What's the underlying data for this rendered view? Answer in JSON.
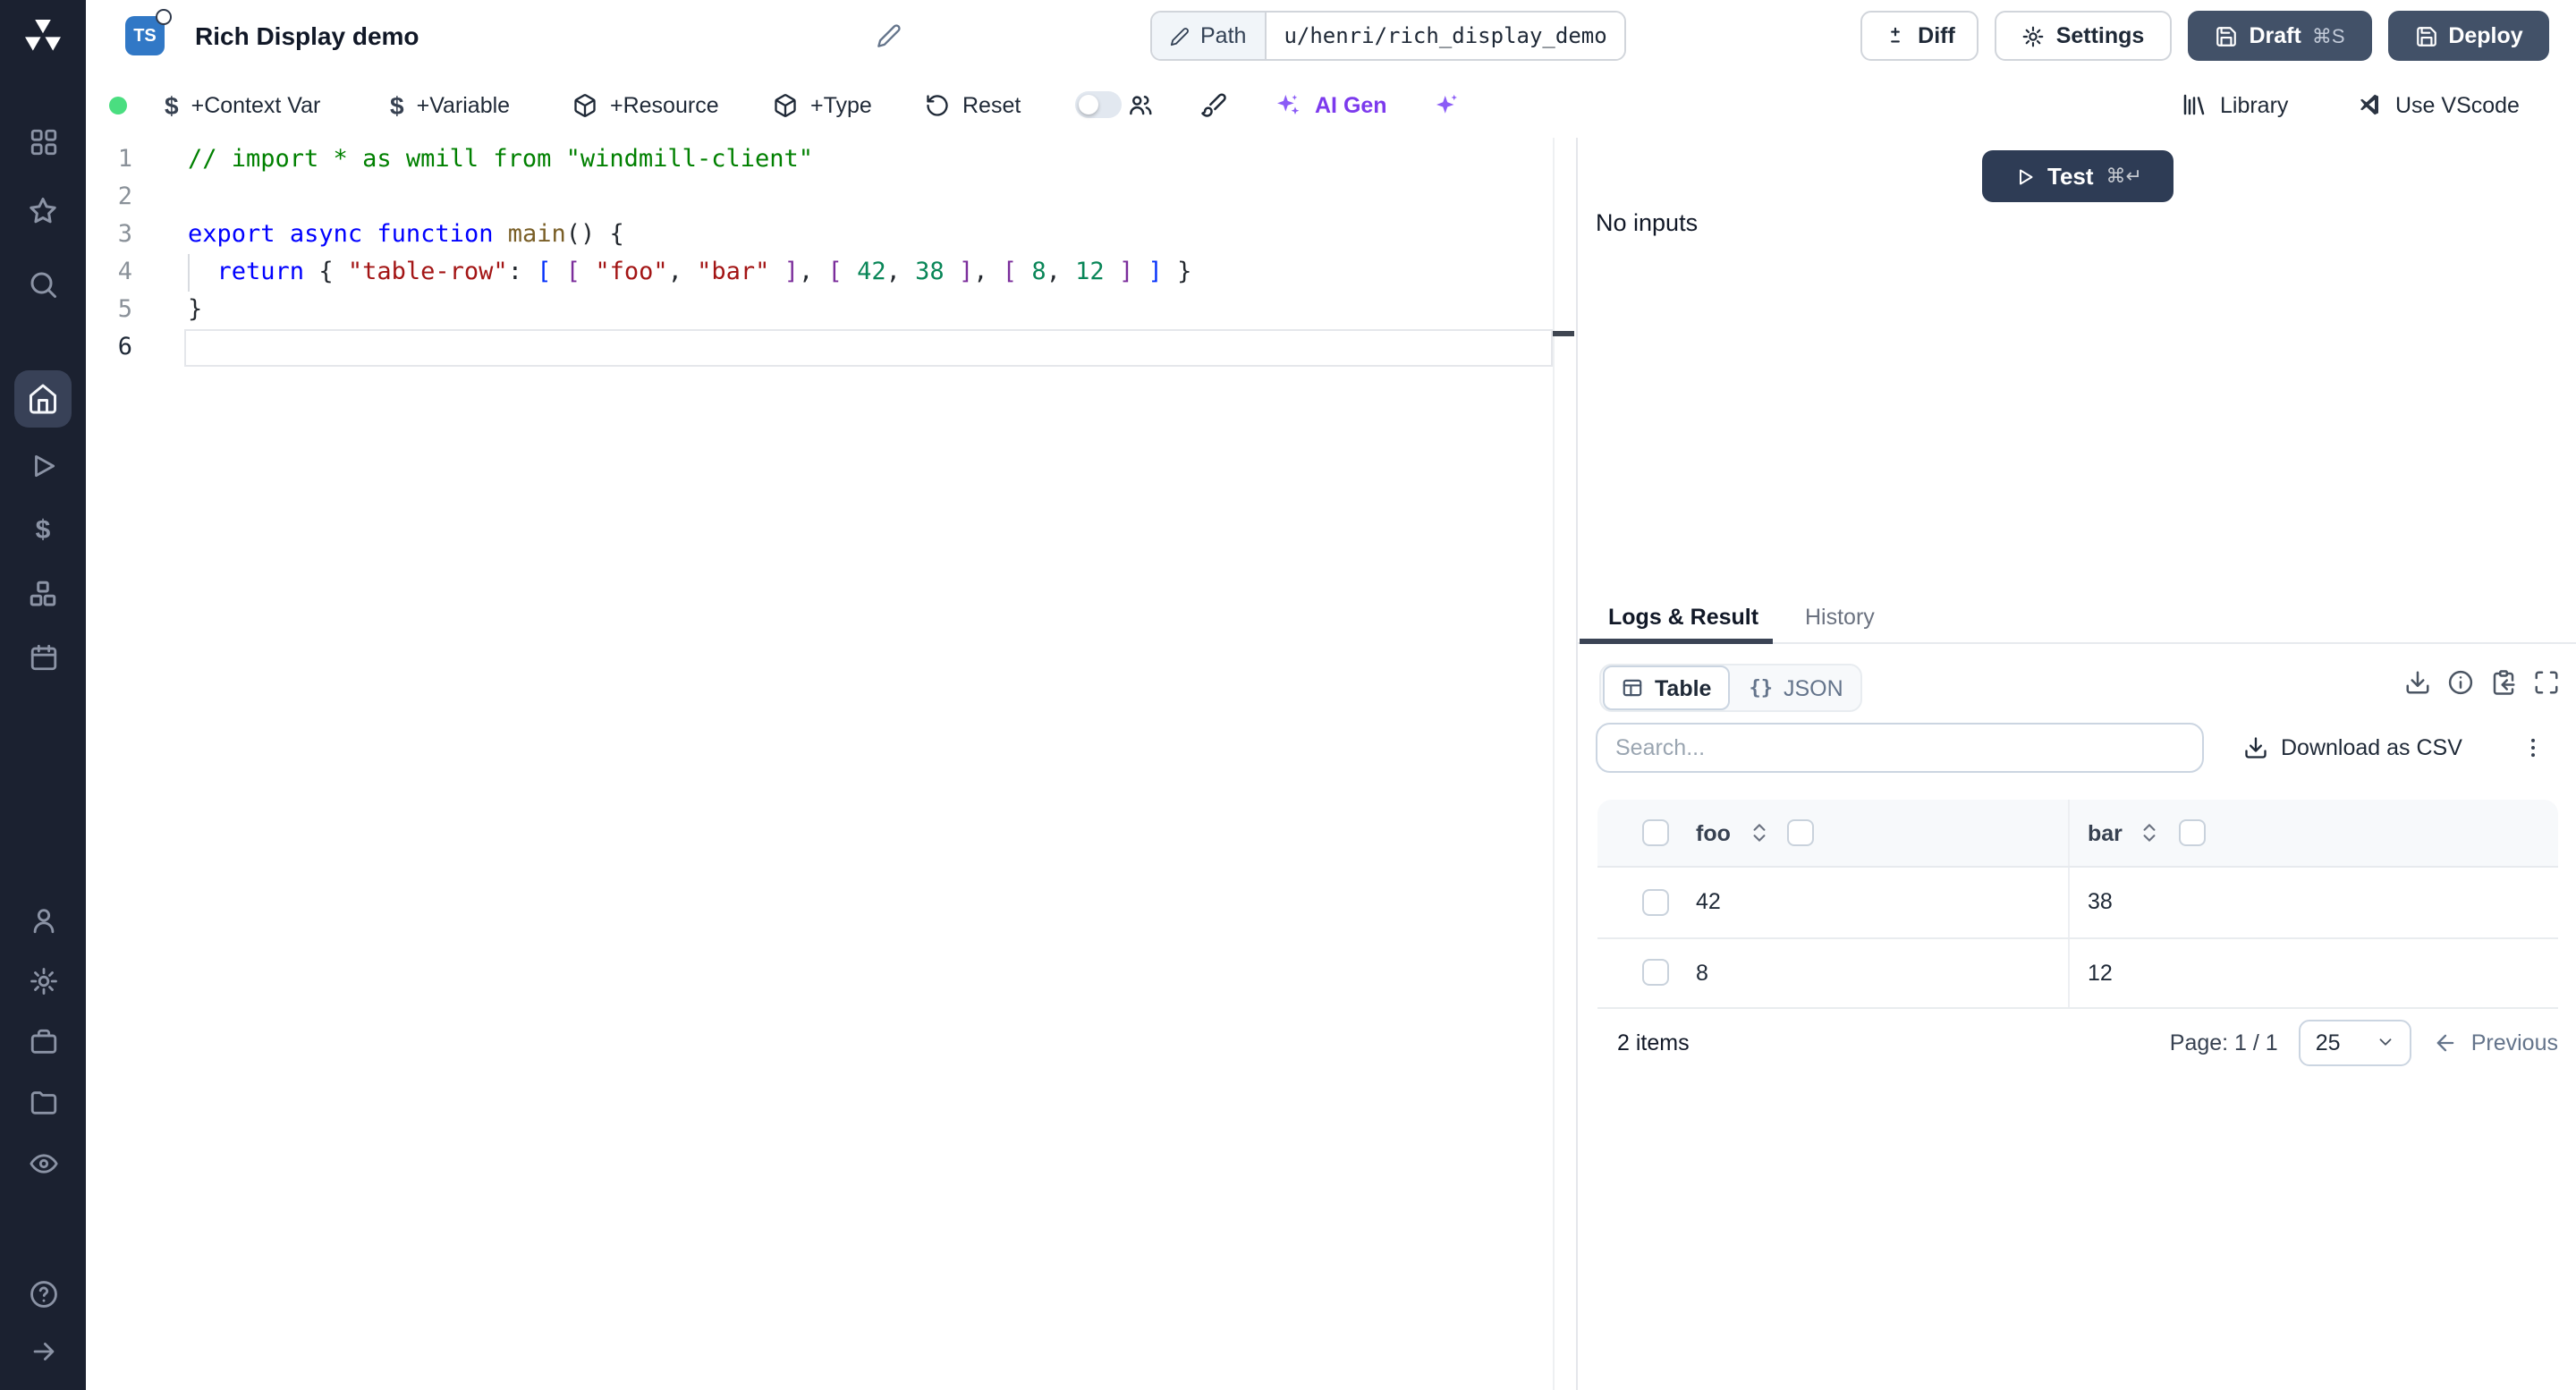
{
  "colors": {
    "sidebar_bg": "#1b2130",
    "accent_green": "#4ade80",
    "ai_violet": "#7c3aed",
    "ts_blue": "#3178c6",
    "dark_button": "#425168",
    "test_button": "#2e3c55"
  },
  "sidebar": {
    "icons": [
      "windmill-logo",
      "apps",
      "favorites",
      "search",
      "home",
      "runs",
      "variables",
      "resources",
      "schedules",
      "user",
      "settings",
      "jobs",
      "folders",
      "audit-logs",
      "help",
      "expand"
    ]
  },
  "topbar": {
    "lang_badge": "TS",
    "title": "Rich Display demo",
    "path_label": "Path",
    "path_value": "u/henri/rich_display_demo",
    "diff_label": "Diff",
    "settings_label": "Settings",
    "draft_label": "Draft",
    "draft_shortcut": "⌘S",
    "deploy_label": "Deploy"
  },
  "toolbar": {
    "dollar_glyph": "$",
    "context_var": "+Context Var",
    "variable": "+Variable",
    "resource": "+Resource",
    "type": "+Type",
    "reset": "Reset",
    "ai_gen": "AI Gen",
    "library": "Library",
    "vscode": "Use VScode"
  },
  "editor": {
    "lines": [
      {
        "n": "1",
        "tokens": [
          {
            "t": "// import * as wmill from \"windmill-client\"",
            "c": "cmt"
          }
        ]
      },
      {
        "n": "2",
        "tokens": []
      },
      {
        "n": "3",
        "tokens": [
          {
            "t": "export",
            "c": "kw"
          },
          {
            "t": " ",
            "c": "pl"
          },
          {
            "t": "async",
            "c": "kw"
          },
          {
            "t": " ",
            "c": "pl"
          },
          {
            "t": "function",
            "c": "kw"
          },
          {
            "t": " ",
            "c": "pl"
          },
          {
            "t": "main",
            "c": "fn"
          },
          {
            "t": "() {",
            "c": "pl"
          }
        ]
      },
      {
        "n": "4",
        "tokens": [
          {
            "t": "  ",
            "c": "pl"
          },
          {
            "t": "return",
            "c": "kw"
          },
          {
            "t": " { ",
            "c": "pl"
          },
          {
            "t": "\"table-row\"",
            "c": "str"
          },
          {
            "t": ": ",
            "c": "pl"
          },
          {
            "t": "[",
            "c": "br1"
          },
          {
            "t": " ",
            "c": "pl"
          },
          {
            "t": "[",
            "c": "br2"
          },
          {
            "t": " ",
            "c": "pl"
          },
          {
            "t": "\"foo\"",
            "c": "str"
          },
          {
            "t": ", ",
            "c": "pl"
          },
          {
            "t": "\"bar\"",
            "c": "str"
          },
          {
            "t": " ",
            "c": "pl"
          },
          {
            "t": "]",
            "c": "br2"
          },
          {
            "t": ", ",
            "c": "pl"
          },
          {
            "t": "[",
            "c": "br2"
          },
          {
            "t": " ",
            "c": "pl"
          },
          {
            "t": "42",
            "c": "num"
          },
          {
            "t": ", ",
            "c": "pl"
          },
          {
            "t": "38",
            "c": "num"
          },
          {
            "t": " ",
            "c": "pl"
          },
          {
            "t": "]",
            "c": "br2"
          },
          {
            "t": ", ",
            "c": "pl"
          },
          {
            "t": "[",
            "c": "br2"
          },
          {
            "t": " ",
            "c": "pl"
          },
          {
            "t": "8",
            "c": "num"
          },
          {
            "t": ", ",
            "c": "pl"
          },
          {
            "t": "12",
            "c": "num"
          },
          {
            "t": " ",
            "c": "pl"
          },
          {
            "t": "]",
            "c": "br2"
          },
          {
            "t": " ",
            "c": "pl"
          },
          {
            "t": "]",
            "c": "br1"
          },
          {
            "t": " }",
            "c": "pl"
          }
        ]
      },
      {
        "n": "5",
        "tokens": [
          {
            "t": "}",
            "c": "pl"
          }
        ]
      },
      {
        "n": "6",
        "tokens": [],
        "active": true
      }
    ]
  },
  "runner": {
    "test_label": "Test",
    "test_shortcut": "⌘↵",
    "no_inputs": "No inputs"
  },
  "result_panel": {
    "tabs": [
      {
        "label": "Logs & Result",
        "active": true
      },
      {
        "label": "History",
        "active": false
      }
    ],
    "view_toggle": [
      {
        "label": "Table",
        "active": true
      },
      {
        "label": "JSON",
        "active": false
      }
    ],
    "json_glyph": "{}",
    "search_placeholder": "Search...",
    "download_csv_label": "Download as CSV",
    "table": {
      "columns": [
        "foo",
        "bar"
      ],
      "rows": [
        [
          "42",
          "38"
        ],
        [
          "8",
          "12"
        ]
      ]
    },
    "footer": {
      "items_text": "2 items",
      "page_text": "Page: 1 / 1",
      "page_size": "25",
      "previous_label": "Previous"
    }
  }
}
